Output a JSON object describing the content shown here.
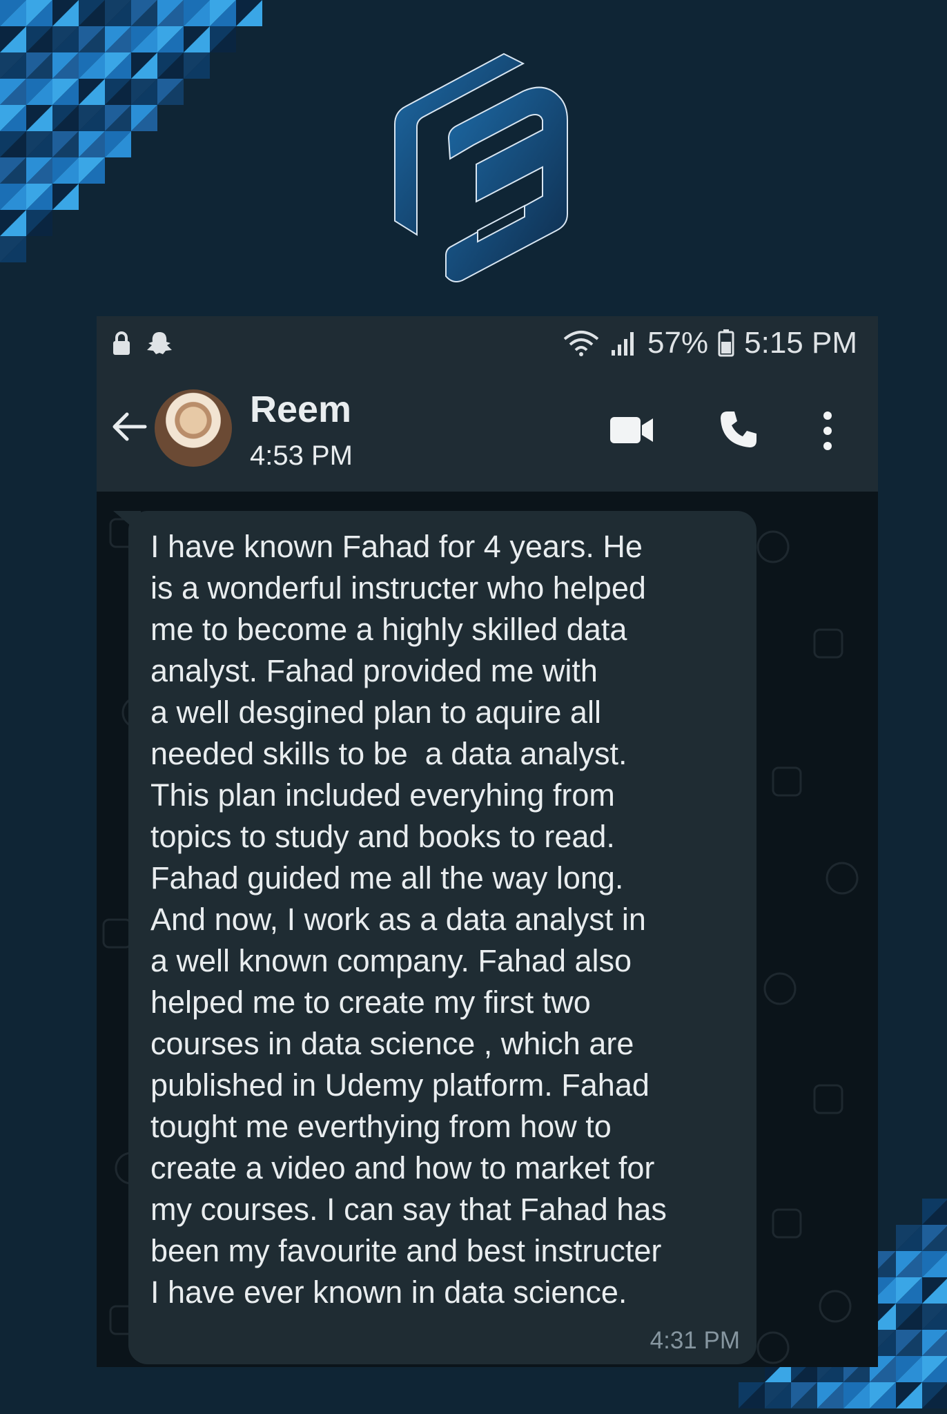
{
  "status_bar": {
    "icons_left": [
      "lock-icon",
      "snapchat-icon"
    ],
    "icons_right": [
      "wifi-icon",
      "signal-icon",
      "battery-icon"
    ],
    "battery": "57%",
    "time": "5:15 PM"
  },
  "chat_header": {
    "contact_name": "Reem",
    "last_seen": "4:53 PM",
    "actions": [
      "video-call-icon",
      "phone-call-icon",
      "more-options-icon"
    ]
  },
  "message": {
    "text": "I have known Fahad for 4 years. He\nis a wonderful instructer who helped\nme to become a highly skilled data\nanalyst. Fahad provided me with\na well desgined plan to aquire all\nneeded skills to be  a data analyst.\nThis plan included everyhing from\ntopics to study and books to read.\nFahad guided me all the way long.\nAnd now, I work as a data analyst in\na well known company. Fahad also\nhelped me to create my first two\ncourses in data science , which are\npublished in Udemy platform. Fahad\ntought me everthying from how to\ncreate a video and how to market for\nmy courses. I can say that Fahad has\nbeen my favourite and best instructer\nI have ever known in data science.",
    "time": "4:31 PM"
  },
  "colors": {
    "page_background": "#0f2535",
    "header_background": "#1f2c34",
    "chat_background": "#0b141a",
    "bubble_background": "#1f2c33",
    "text_primary": "#e9edef",
    "text_secondary": "#8696a0",
    "logo_blue": "#1b5f96"
  }
}
